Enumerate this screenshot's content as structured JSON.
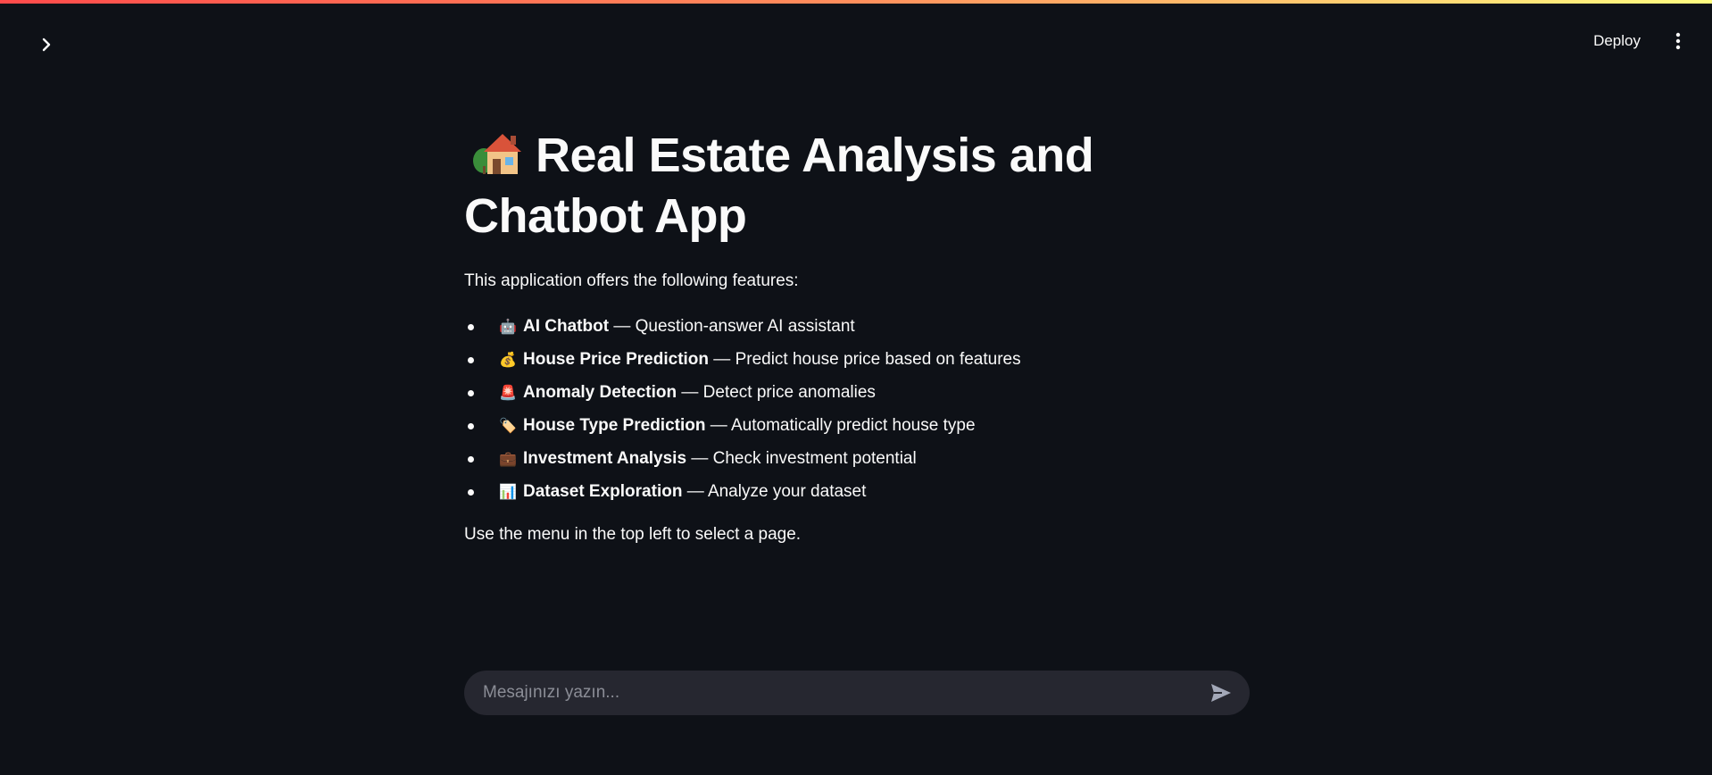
{
  "header": {
    "deploy_label": "Deploy",
    "sidebar_toggle_icon": "chevron-right-icon",
    "menu_icon": "vertical-ellipsis-icon"
  },
  "main": {
    "title_emoji": "house-with-garden-icon",
    "title": "Real Estate Analysis and Chatbot App",
    "intro": "This application offers the following features:",
    "features": [
      {
        "emoji": "🤖",
        "icon": "robot-icon",
        "name": "AI Chatbot",
        "description": " — Question-answer AI assistant"
      },
      {
        "emoji": "💰",
        "icon": "money-bag-icon",
        "name": "House Price Prediction",
        "description": " — Predict house price based on features"
      },
      {
        "emoji": "🚨",
        "icon": "police-light-icon",
        "name": "Anomaly Detection",
        "description": " — Detect price anomalies"
      },
      {
        "emoji": "🏷️",
        "icon": "label-tag-icon",
        "name": "House Type Prediction",
        "description": " — Automatically predict house type"
      },
      {
        "emoji": "💼",
        "icon": "briefcase-icon",
        "name": "Investment Analysis",
        "description": " — Check investment potential"
      },
      {
        "emoji": "📊",
        "icon": "bar-chart-icon",
        "name": "Dataset Exploration",
        "description": " — Analyze your dataset"
      }
    ],
    "footer_note": "Use the menu in the top left to select a page."
  },
  "chat": {
    "placeholder": "Mesajınızı yazın...",
    "value": "",
    "send_icon": "send-icon"
  },
  "colors": {
    "background": "#0e1117",
    "text": "#fafafa",
    "chat_bar": "#262730",
    "placeholder": "#8b8d96",
    "gradient_start": "#ff4b4b",
    "gradient_end": "#fffd80"
  }
}
